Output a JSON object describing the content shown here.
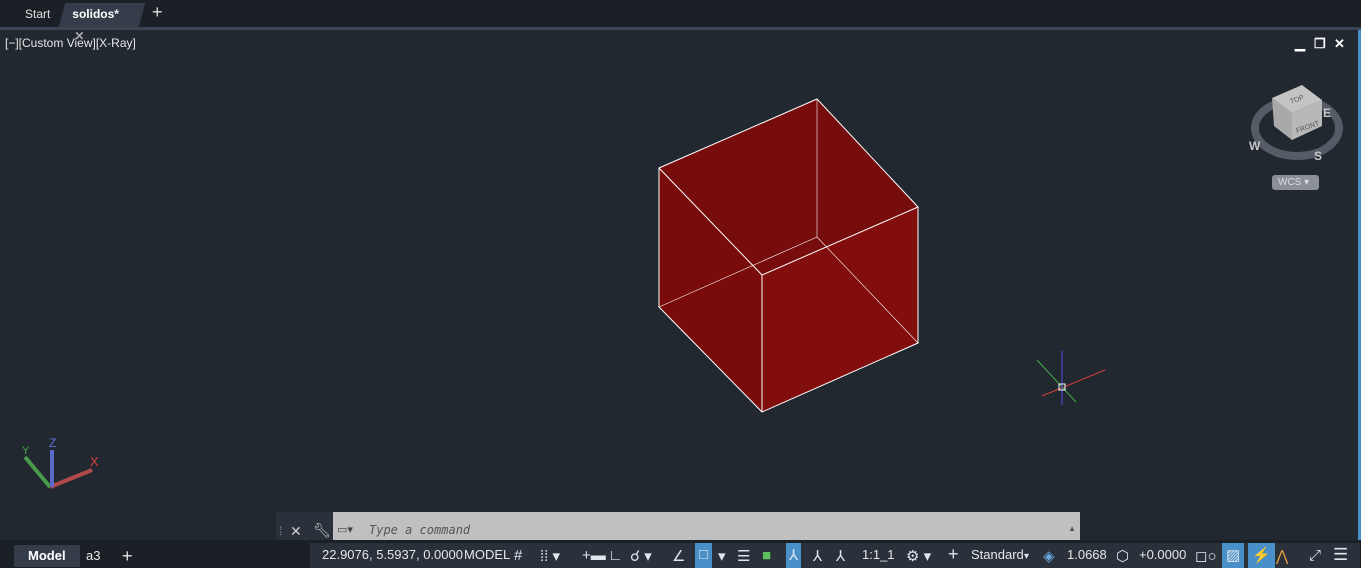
{
  "tabs": [
    {
      "label": "Start"
    },
    {
      "label": "solidos*"
    }
  ],
  "viewport": {
    "label": "[−][Custom View][X-Ray]"
  },
  "viewcube": {
    "top": "TOP",
    "front": "FRONT",
    "compass": [
      "W",
      "E",
      "S"
    ],
    "ucs": "WCS"
  },
  "ucs_icon": {
    "x": "X",
    "y": "Y",
    "z": "Z"
  },
  "command": {
    "placeholder": "Type a command"
  },
  "layout_tabs": [
    {
      "label": "Model"
    },
    {
      "label": "a3"
    }
  ],
  "status": {
    "coords": "22.9076, 5.5937, 0.0000",
    "space": "MODEL",
    "scale": "1:1_1",
    "style": "Standard",
    "lineweight": "1.0668",
    "elevation": "+0.0000"
  },
  "colors": {
    "solid_front": "#7f0c0c",
    "background": "#212830"
  }
}
